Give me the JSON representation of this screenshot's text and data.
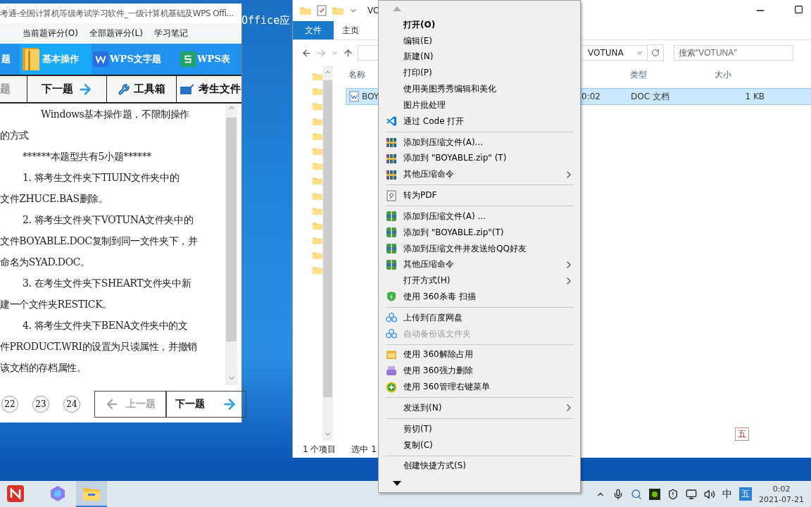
{
  "background_window": {
    "title": "Office应"
  },
  "exam_window": {
    "title": "考通-全国计算机等级考试学习软件_一级计算机基础及WPS Offi...",
    "menu": [
      "当前题评分(O)",
      "全部题评分(L)",
      "学习笔记"
    ],
    "categories": [
      {
        "label": "题",
        "selected": false
      },
      {
        "label": "基本操作",
        "selected": true
      },
      {
        "label": "WPS文字题",
        "selected": false
      },
      {
        "label": "WPS表",
        "selected": false
      }
    ],
    "toolbar": [
      {
        "label": "题",
        "disabled": true
      },
      {
        "label": "下一题",
        "disabled": false
      },
      {
        "label": "工具箱",
        "disabled": false
      },
      {
        "label": "考生文件",
        "disabled": false
      }
    ],
    "question_lines": [
      {
        "kind": "lead",
        "text": "Windows基本操作题，不限制操作"
      },
      {
        "kind": "cont",
        "text": "的方式"
      },
      {
        "kind": "para",
        "text": "******本题型共有5小题******"
      },
      {
        "kind": "para",
        "text": "1. 将考生文件夹下TIUIN文件夹中的"
      },
      {
        "kind": "cont",
        "text": "文件ZHUCE.BAS删除。"
      },
      {
        "kind": "para",
        "text": "2. 将考生文件夹下VOTUNA文件夹中的"
      },
      {
        "kind": "cont",
        "text": "文件BOYABLE.DOC复制到同一文件夹下，并"
      },
      {
        "kind": "cont",
        "text": "命名为SYAD.DOC。"
      },
      {
        "kind": "para",
        "text": "3. 在考生文件夹下SHEART文件夹中新"
      },
      {
        "kind": "cont",
        "text": "建一个文件夹RESTICK。"
      },
      {
        "kind": "para",
        "text": "4. 将考生文件夹下BENA文件夹中的文"
      },
      {
        "kind": "cont",
        "text": "件PRODUCT.WRI的设置为只读属性，并撤销"
      },
      {
        "kind": "cont",
        "text": "该文档的存档属性。"
      }
    ],
    "pages": [
      "22",
      "23",
      "24"
    ],
    "pager_buttons": [
      {
        "label": "上一题",
        "disabled": true
      },
      {
        "label": "下一题",
        "disabled": false
      }
    ]
  },
  "explorer": {
    "title": "VO",
    "ribbon_tabs": [
      {
        "label": "文件",
        "selected": true
      },
      {
        "label": "主页",
        "selected": false
      }
    ],
    "address": "VOTUNA",
    "search": {
      "placeholder": "搜索\"VOTUNA\""
    },
    "columns": [
      "名称",
      "类型",
      "大小"
    ],
    "rows": [
      {
        "name": "BOY",
        "column_2": "0:02",
        "type": "DOC 文档",
        "size": "1 KB",
        "selected": true
      }
    ],
    "status_bar": [
      "1 个项目",
      "选中 1"
    ]
  },
  "context_menu": {
    "items": [
      {
        "kind": "plain",
        "label": "打开(O)",
        "default": true,
        "submenu": false,
        "disabled": false
      },
      {
        "kind": "plain",
        "label": "编辑(E)",
        "default": false,
        "submenu": false,
        "disabled": false
      },
      {
        "kind": "plain",
        "label": "新建(N)",
        "default": false,
        "submenu": false,
        "disabled": false
      },
      {
        "kind": "plain",
        "label": "打印(P)",
        "default": false,
        "submenu": false,
        "disabled": false
      },
      {
        "kind": "plain",
        "label": "使用美图秀秀编辑和美化",
        "default": false,
        "submenu": false,
        "disabled": false
      },
      {
        "kind": "plain",
        "label": "图片批处理",
        "default": false,
        "submenu": false,
        "disabled": false
      },
      {
        "kind": "code",
        "label": "通过 Code 打开",
        "default": false,
        "submenu": false,
        "disabled": false
      },
      {
        "kind": "separator"
      },
      {
        "kind": "books",
        "label": "添加到压缩文件(A)...",
        "default": false,
        "submenu": false,
        "disabled": false
      },
      {
        "kind": "books",
        "label": "添加到 \"BOYABLE.zip\" (T)",
        "default": false,
        "submenu": false,
        "disabled": false
      },
      {
        "kind": "books",
        "label": "其他压缩命令",
        "default": false,
        "submenu": true,
        "disabled": false
      },
      {
        "kind": "separator"
      },
      {
        "kind": "pdf",
        "label": "转为PDF",
        "default": false,
        "submenu": false,
        "disabled": false
      },
      {
        "kind": "separator"
      },
      {
        "kind": "archive",
        "label": "添加到压缩文件(A) ...",
        "default": false,
        "submenu": false,
        "disabled": false
      },
      {
        "kind": "archive",
        "label": "添加到 \"BOYABLE.zip\"(T)",
        "default": false,
        "submenu": false,
        "disabled": false
      },
      {
        "kind": "archive",
        "label": "添加到压缩文件并发送给QQ好友",
        "default": false,
        "submenu": false,
        "disabled": false
      },
      {
        "kind": "archive",
        "label": "其他压缩命令",
        "default": false,
        "submenu": true,
        "disabled": false
      },
      {
        "kind": "plain",
        "label": "打开方式(H)",
        "default": false,
        "submenu": true,
        "disabled": false
      },
      {
        "kind": "shield",
        "label": "使用 360杀毒 扫描",
        "default": false,
        "submenu": false,
        "disabled": false
      },
      {
        "kind": "separator"
      },
      {
        "kind": "cloud",
        "label": "上传到百度网盘",
        "default": false,
        "submenu": false,
        "disabled": false
      },
      {
        "kind": "cloud",
        "label": "自动备份该文件夹",
        "default": false,
        "submenu": false,
        "disabled": true
      },
      {
        "kind": "separator"
      },
      {
        "kind": "unlock",
        "label": "使用 360解除占用",
        "default": false,
        "submenu": false,
        "disabled": false
      },
      {
        "kind": "shredder",
        "label": "使用 360强力删除",
        "default": false,
        "submenu": false,
        "disabled": false
      },
      {
        "kind": "manager",
        "label": "使用 360管理右键菜单",
        "default": false,
        "submenu": false,
        "disabled": false
      },
      {
        "kind": "separator"
      },
      {
        "kind": "plain",
        "label": "发送到(N)",
        "default": false,
        "submenu": true,
        "disabled": false
      },
      {
        "kind": "separator"
      },
      {
        "kind": "plain",
        "label": "剪切(T)",
        "default": false,
        "submenu": false,
        "disabled": false
      },
      {
        "kind": "plain",
        "label": "复制(C)",
        "default": false,
        "submenu": false,
        "disabled": false
      },
      {
        "kind": "separator"
      },
      {
        "kind": "plain",
        "label": "创建快捷方式(S)",
        "default": false,
        "submenu": false,
        "disabled": false
      }
    ]
  },
  "ime_bar": "五",
  "taskbar": {
    "apps": [
      {
        "selected": false
      },
      {
        "selected": false
      },
      {
        "selected": true
      }
    ],
    "ime": [
      "中",
      "五"
    ],
    "time": "0:02",
    "date": "2021-07-21"
  }
}
